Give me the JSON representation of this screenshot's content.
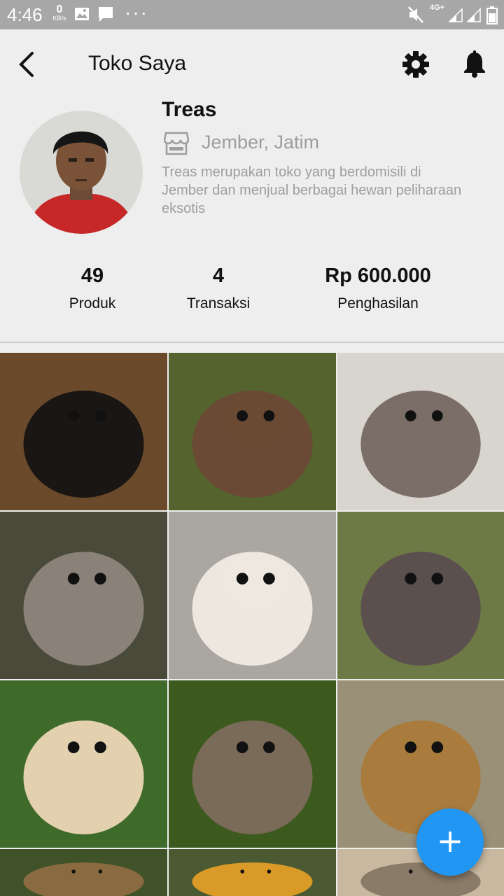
{
  "status_bar": {
    "time": "4:46",
    "net_speed_value": "0",
    "net_speed_unit": "KB/s",
    "network_type": "4G+",
    "icons": [
      "image-icon",
      "message-icon",
      "more-dots-icon",
      "mute-icon",
      "signal-icon",
      "signal-icon",
      "battery-icon"
    ]
  },
  "appbar": {
    "title": "Toko Saya",
    "icons": [
      "back-arrow-icon",
      "gear-icon",
      "bell-icon"
    ]
  },
  "profile": {
    "name": "Treas",
    "location": "Jember, Jatim",
    "description": "Treas merupakan toko yang berdomisili di Jember dan menjual berbagai hewan peliharaan eksotis"
  },
  "stats": [
    {
      "value": "49",
      "label": "Produk"
    },
    {
      "value": "4",
      "label": "Transaksi"
    },
    {
      "value": "Rp 600.000",
      "label": "Penghasilan"
    }
  ],
  "products": [
    {
      "subject": "tarantula",
      "bg": "#6b4a2c",
      "accent": "#1a1614"
    },
    {
      "subject": "hedgehog",
      "bg": "#55642e",
      "accent": "#6a4a34"
    },
    {
      "subject": "sugar-glider",
      "bg": "#d8d4ce",
      "accent": "#7a6e66"
    },
    {
      "subject": "civet",
      "bg": "#4a4a3a",
      "accent": "#8a8278"
    },
    {
      "subject": "hamster",
      "bg": "#aaa6a0",
      "accent": "#ede7e0"
    },
    {
      "subject": "angora-rabbit",
      "bg": "#6d7a45",
      "accent": "#5b504e"
    },
    {
      "subject": "gibbons",
      "bg": "#3e6a2a",
      "accent": "#e3d0ae"
    },
    {
      "subject": "tarsier",
      "bg": "#3c5a1e",
      "accent": "#7a6a58"
    },
    {
      "subject": "slow-loris",
      "bg": "#9a9078",
      "accent": "#a97c3e"
    },
    {
      "subject": "animal-partial",
      "bg": "#3f5228",
      "accent": "#8a6a40"
    },
    {
      "subject": "tamarin",
      "bg": "#4b5a32",
      "accent": "#d99a28"
    },
    {
      "subject": "animal-partial",
      "bg": "#c9b8a0",
      "accent": "#8a7a68"
    }
  ],
  "fab": {
    "symbol": "+"
  }
}
